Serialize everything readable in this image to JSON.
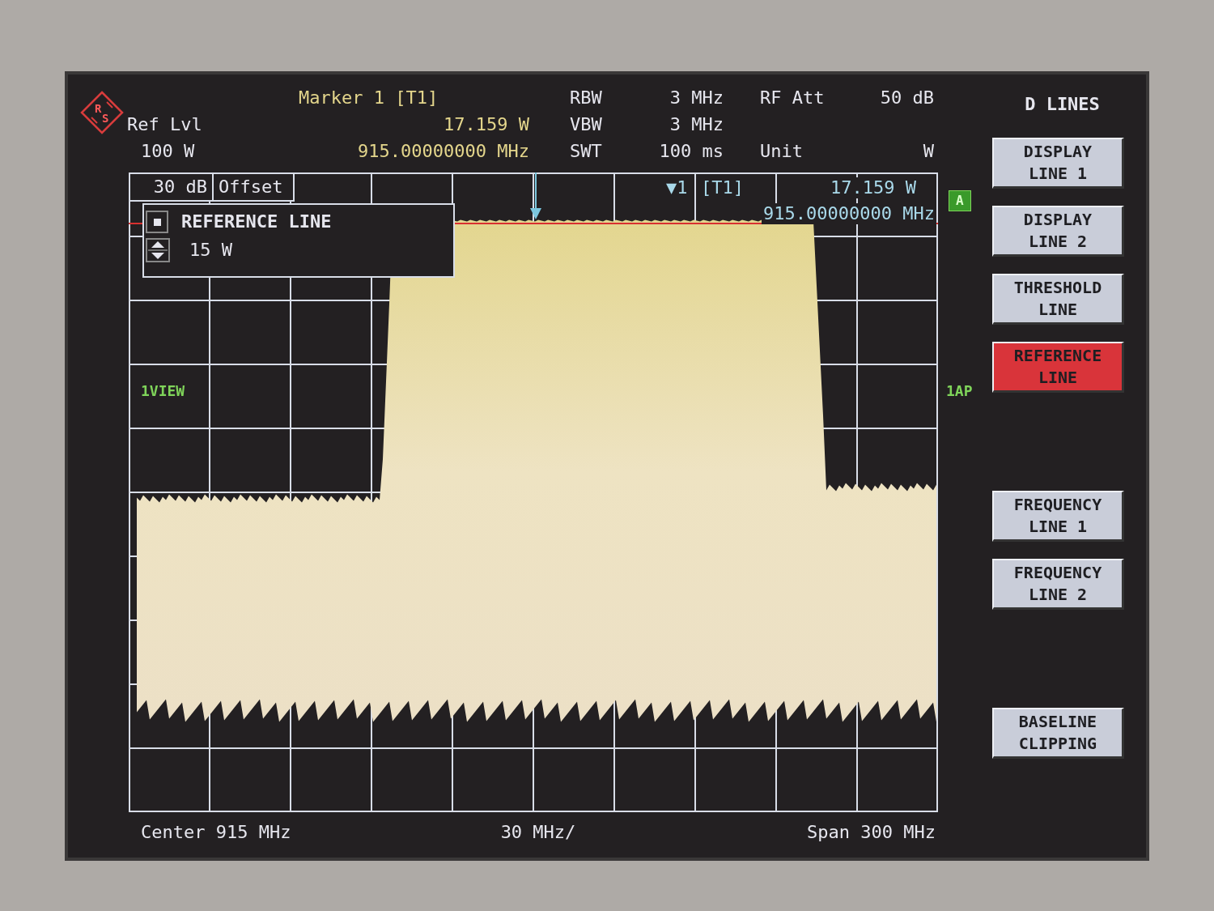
{
  "logo": {
    "letters": [
      "R",
      "S"
    ]
  },
  "ref_level": {
    "label": "Ref Lvl",
    "value": "100 W"
  },
  "marker": {
    "title": "Marker 1 [T1]",
    "reading": "17.159 W",
    "frequency": "915.00000000 MHz"
  },
  "settings_columns": [
    [
      {
        "label": "RBW",
        "value": "3 MHz"
      },
      {
        "label": "VBW",
        "value": "3 MHz"
      },
      {
        "label": "SWT",
        "value": "100 ms"
      }
    ],
    [
      {
        "label": "RF Att",
        "value": "50 dB"
      },
      {
        "label": "Unit",
        "value": "W"
      }
    ]
  ],
  "plot": {
    "offset_cells": [
      "30 dB",
      "Offset"
    ],
    "marker_info": {
      "symbol": "▼1",
      "trace": "[T1]",
      "reading": "17.159 W",
      "frequency": "915.00000000 MHz"
    },
    "reference_line_box": {
      "title": "REFERENCE LINE",
      "value": "15 W"
    },
    "left_label": "1VIEW",
    "right_labels": [
      {
        "text": "A",
        "kind": "badge"
      },
      {
        "text": "1AP",
        "kind": "plain"
      }
    ]
  },
  "footer": [
    "Center 915 MHz",
    "30 MHz/",
    "Span 300 MHz"
  ],
  "softkeys": {
    "title": "D LINES",
    "keys": [
      {
        "kind": "key",
        "lines": [
          "DISPLAY",
          "LINE 1"
        ],
        "selected": false
      },
      {
        "kind": "key",
        "lines": [
          "DISPLAY",
          "LINE 2"
        ],
        "selected": false
      },
      {
        "kind": "key",
        "lines": [
          "THRESHOLD",
          "LINE"
        ],
        "selected": false
      },
      {
        "kind": "key",
        "lines": [
          "REFERENCE",
          "LINE"
        ],
        "selected": true
      },
      {
        "kind": "blank"
      },
      {
        "kind": "key",
        "lines": [
          "FREQUENCY",
          "LINE 1"
        ],
        "selected": false
      },
      {
        "kind": "key",
        "lines": [
          "FREQUENCY",
          "LINE 2"
        ],
        "selected": false
      },
      {
        "kind": "blank"
      },
      {
        "kind": "key",
        "lines": [
          "BASELINE",
          "CLIPPING"
        ],
        "selected": false
      }
    ]
  }
}
